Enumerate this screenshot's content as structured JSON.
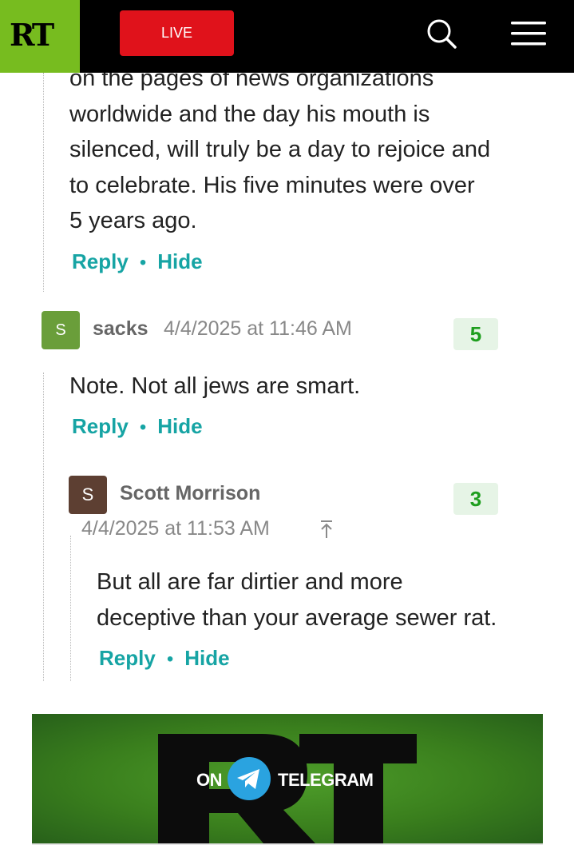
{
  "header": {
    "logo_text": "RT",
    "live_label": "LIVE",
    "brand_color": "#77bc1f",
    "live_color": "#e0121b"
  },
  "comments": [
    {
      "text_lines": [
        "on the pages of news organizations",
        "worldwide and the day his mouth is",
        "silenced, will truly be a day to rejoice and",
        "to celebrate. His five minutes were over",
        "5 years ago."
      ],
      "reply_label": "Reply",
      "hide_label": "Hide"
    },
    {
      "avatar_letter": "S",
      "avatar_color": "#6a9e3a",
      "author": "sacks",
      "date": "4/4/2025 at 11:46 AM",
      "score": "5",
      "text_lines": [
        "Note. Not all jews are smart."
      ],
      "reply_label": "Reply",
      "hide_label": "Hide"
    },
    {
      "avatar_letter": "S",
      "avatar_color": "#5d3f32",
      "author": "Scott Morrison",
      "date": "4/4/2025 at 11:53 AM",
      "score": "3",
      "text_lines": [
        "But all are far dirtier and more",
        "deceptive than your average sewer rat."
      ],
      "reply_label": "Reply",
      "hide_label": "Hide"
    }
  ],
  "banner": {
    "logo_text": "RT",
    "on_label": "ON",
    "telegram_label": "TELEGRAM",
    "telegram_color": "#2aa3e0"
  },
  "accent_color": "#16a4a4"
}
